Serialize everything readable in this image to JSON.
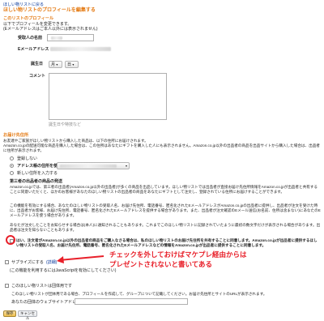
{
  "header": {
    "back_link": "ほしい物リストに戻る",
    "page_title": "ほしい物リストのプロフィールを編集する"
  },
  "profile": {
    "section_title": "このリストのプロフィール",
    "note1": "以下でプロフィールを変更できます。",
    "note2": "(Eメールアドレスはご本人以外には表示されません)",
    "name_label": "受取人の名前",
    "email_label": "Eメールアドレス",
    "birthday_label": "誕生日",
    "month_select": "月",
    "day_select": "日",
    "comment_label": "コメント",
    "comment_hint": "(最大 1,000字 まで)",
    "comment_counter": "残り1000字",
    "birthday_placeholder": "誕生日や特技など"
  },
  "shipping": {
    "section_title": "お届け先住所",
    "desc1": "お友達やご家族がほしい物リストから購入した商品は、以下の住所にお届けされます。",
    "desc2": "Amazon.co.jpの配送可能な商品を購入した場合は、この住所はあなたにギフトを購入した人にも表示されません。Amazon.co.jp以外の出品者の商品を出品サイトから購入した場合は、出品者に住所が表示されます。",
    "option_none": "登録しない",
    "option_address_book": "アドレス帳の住所を使う",
    "option_new": "新しい住所を入力する",
    "third_party_title": "第三者の出品者の商品の発送",
    "third_party_desc": "Amazon.co.jpでは、第三者の出品者(Amazon.co.jp以外の出品者)が多くの商品を出品しています。ほしい物リストでは出品者が直接お届け先住所情報をAmazon.co.jpが出品者と共有することに同意いただくと、ほかのお客様があなたのほしい物リストの出品者の商品をあなたにギフトとして注文し、登録されている住所にお届けすることができます。",
    "consent_desc": "この機能を有効にする場合、あなたのほしい物リストの受取人名、お届け先住所、電話番号、匿名化されたEメールアドレスがAmazon.co.jpの出品者に提供し、出品者が注文を受けた時に、出品者がお客様、お届け先住所、電話番号、匿名化されたEメールアドレスを提供する場合があります。また、出品者が注文確認のEメール送信(お名前、住所は含まない)にあなたのEメールアドレスを使う場合があります。",
    "consent_desc2": "あなたが注文したことをお知らせする場合は(本人)に通知されることもあります。これまでこのほしい物リストに記録されていたように最初の数文字だけが表示される場合があります。出品者は注文を知らないこともあります。",
    "consent_bold": "はい、注文者がAmazon.co.jp以外の出品者の商品をご購入なさる場合は、私のほしい物リストのお届け先住所を共有することに同意します。Amazon.co.jpが出品者に提供するほしい物リストの受取人名、お届け先住所、電話番号、匿名化されたEメールアドレスなどの情報をAmazon.co.jpが出品者に提供することに同意します。",
    "surprise_label": "サプライズにする",
    "surprise_link": "(詳細)",
    "surprise_note": "(この機能を利用するにはJavaScriptを有効にしてください)"
  },
  "group": {
    "checkbox_label": "このほしい物リストは団体用です",
    "desc": "このほしい物リストが団体用である場合、プロフィールを作成して、グループについて記載してください。お届け先住所とサイトのURLが表示されます。",
    "website_label": "あなたの団体のウェブサイトアドレス"
  },
  "buttons": {
    "save": "保存",
    "cancel": "キャンセル"
  },
  "annotation": {
    "line1": "チェックを外しておけばマケプレ経由からは",
    "line2": "プレゼントされないと書いてある"
  },
  "colors": {
    "accent": "#e47911",
    "link": "#003399",
    "annotation": "#e8202a"
  }
}
